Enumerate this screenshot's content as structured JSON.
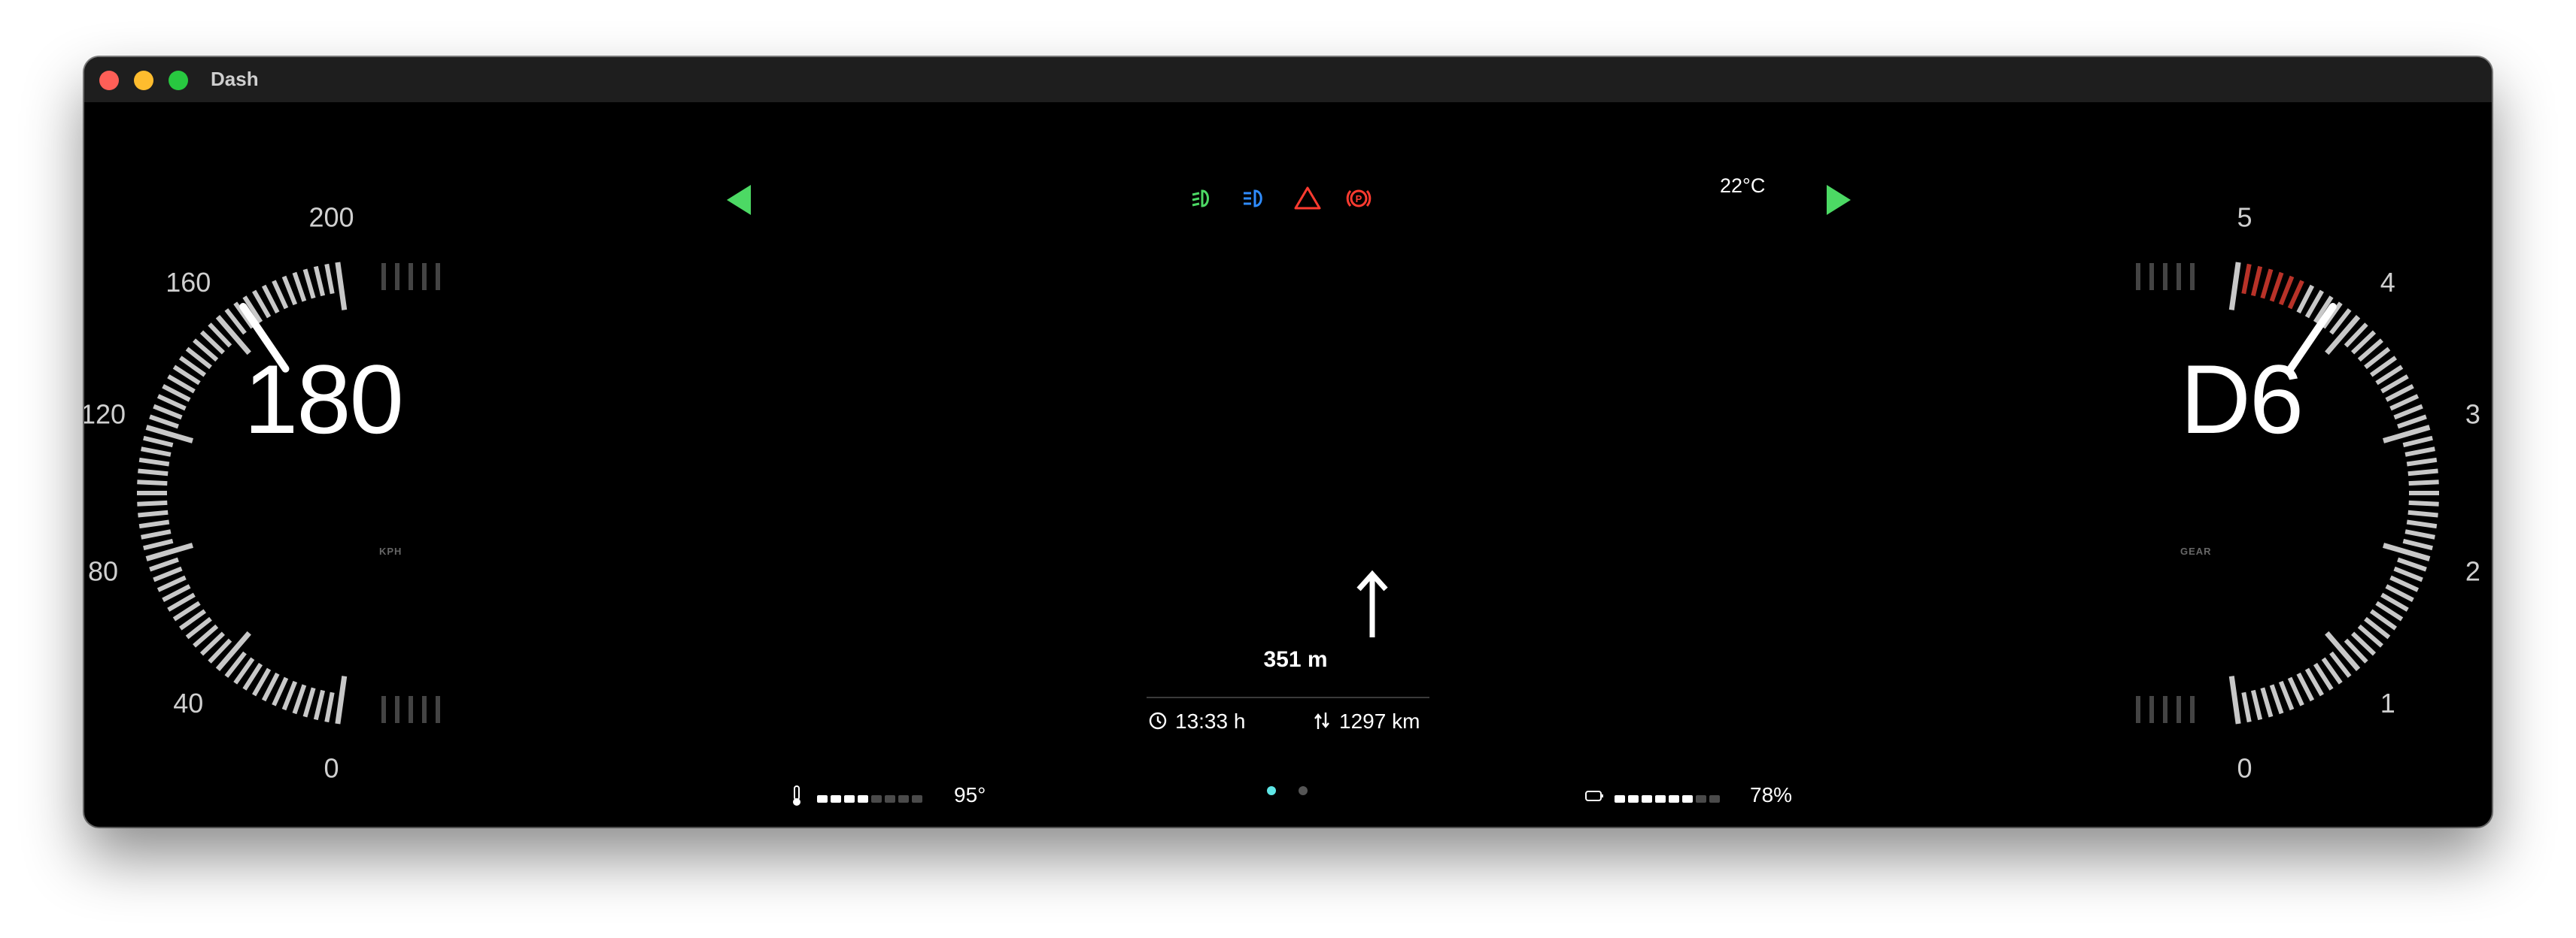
{
  "window": {
    "title": "Dash"
  },
  "speedometer": {
    "value": "180",
    "unit": "KPH",
    "labels": [
      "0",
      "40",
      "80",
      "120",
      "160",
      "200"
    ],
    "max": 200,
    "needle_value": 168
  },
  "gear_gauge": {
    "value": "D6",
    "unit": "GEAR",
    "labels": [
      "0",
      "1",
      "2",
      "3",
      "4",
      "5"
    ],
    "max": 5,
    "needle_value": 4.2,
    "redline_from": 4.5
  },
  "top_bar": {
    "left_arrow": "left-turn-signal-icon",
    "right_arrow": "right-turn-signal-icon",
    "outside_temp": "22°C",
    "warning_icons": [
      "fog-light-icon",
      "high-beam-icon",
      "hazard-icon",
      "parking-brake-icon"
    ]
  },
  "navigation": {
    "direction_icon": "straight-arrow-icon",
    "distance": "351 m",
    "eta": "13:33 h",
    "remaining": "1297 km"
  },
  "bottom_bar": {
    "coolant": {
      "icon": "thermometer-icon",
      "value": "95°",
      "level": 0.55
    },
    "battery": {
      "icon": "battery-icon",
      "value": "78%",
      "level": 0.75
    },
    "page_indicator": {
      "count": 2,
      "active": 0
    }
  },
  "colors": {
    "accent_green": "#4cd964",
    "warning_red": "#ff3b30",
    "info_blue": "#2f8cff",
    "page_active": "#5ee6e6"
  }
}
